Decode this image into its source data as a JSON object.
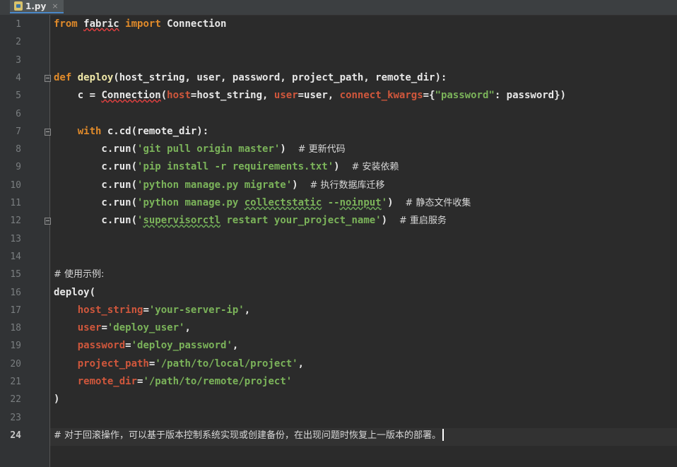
{
  "tab": {
    "filename": "1.py",
    "close": "×"
  },
  "editor": {
    "current_line": 24,
    "lines": [
      {
        "n": "1",
        "t": "from fabric import Connection"
      },
      {
        "n": "2",
        "t": ""
      },
      {
        "n": "3",
        "t": ""
      },
      {
        "n": "4",
        "t": "def deploy(host_string, user, password, project_path, remote_dir):"
      },
      {
        "n": "5",
        "t": "    c = Connection(host=host_string, user=user, connect_kwargs={\"password\": password})"
      },
      {
        "n": "6",
        "t": ""
      },
      {
        "n": "7",
        "t": "    with c.cd(remote_dir):"
      },
      {
        "n": "8",
        "t": "        c.run('git pull origin master')  # 更新代码"
      },
      {
        "n": "9",
        "t": "        c.run('pip install -r requirements.txt')  # 安装依赖"
      },
      {
        "n": "10",
        "t": "        c.run('python manage.py migrate')  # 执行数据库迁移"
      },
      {
        "n": "11",
        "t": "        c.run('python manage.py collectstatic --noinput')  # 静态文件收集"
      },
      {
        "n": "12",
        "t": "        c.run('supervisorctl restart your_project_name')  # 重启服务"
      },
      {
        "n": "13",
        "t": ""
      },
      {
        "n": "14",
        "t": ""
      },
      {
        "n": "15",
        "t": "# 使用示例:"
      },
      {
        "n": "16",
        "t": "deploy("
      },
      {
        "n": "17",
        "t": "    host_string='your-server-ip',"
      },
      {
        "n": "18",
        "t": "    user='deploy_user',"
      },
      {
        "n": "19",
        "t": "    password='deploy_password',"
      },
      {
        "n": "20",
        "t": "    project_path='/path/to/local/project',"
      },
      {
        "n": "21",
        "t": "    remote_dir='/path/to/remote/project'"
      },
      {
        "n": "22",
        "t": ")"
      },
      {
        "n": "23",
        "t": ""
      },
      {
        "n": "24",
        "t": "# 对于回滚操作，可以基于版本控制系统实现或创建备份，在出现问题时恢复上一版本的部署。"
      }
    ]
  },
  "colors": {
    "background": "#2b2b2b",
    "keyword": "#e08a2a",
    "string": "#7bb35a",
    "param": "#d0573c"
  }
}
